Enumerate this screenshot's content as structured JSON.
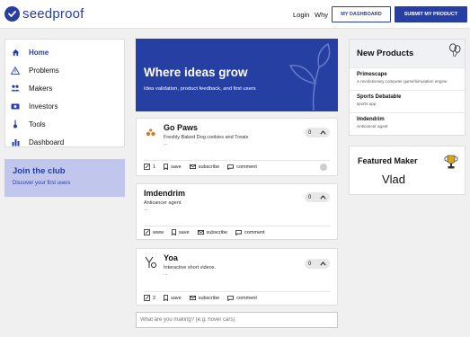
{
  "header": {
    "brand": "seedproof",
    "login_label": "Login",
    "why_label": "Why",
    "dashboard_label": "MY DASHBOARD",
    "submit_label": "SUBMIT MY PRODUCT"
  },
  "sidebar": {
    "items": [
      {
        "label": "Home",
        "icon": "home-icon"
      },
      {
        "label": "Problems",
        "icon": "warning-icon"
      },
      {
        "label": "Makers",
        "icon": "users-icon"
      },
      {
        "label": "Investors",
        "icon": "money-icon"
      },
      {
        "label": "Tools",
        "icon": "tools-icon"
      },
      {
        "label": "Dashboard",
        "icon": "chart-icon"
      }
    ]
  },
  "club": {
    "title": "Join the club",
    "subtitle": "Discover your first users"
  },
  "hero": {
    "title": "Where ideas grow",
    "subtitle": "Idea validation, product feedback, and first users"
  },
  "products": [
    {
      "name": "Go Paws",
      "tagline": "Freshly Baked Dog cookies and Treats",
      "dots": "...",
      "votes": "0",
      "comments_count": "1",
      "save": "save",
      "subscribe": "subscribe",
      "comment": "comment"
    },
    {
      "name": "Imdendrim",
      "tagline": "Anticancer agent",
      "dots": "...",
      "votes": "0",
      "link": "www",
      "save": "save",
      "subscribe": "subscribe",
      "comment": "comment"
    },
    {
      "name": "Yoa",
      "tagline": "Interactive short videos.",
      "dots": "...",
      "votes": "0",
      "comments_count": "2",
      "save": "save",
      "subscribe": "subscribe",
      "comment": "comment"
    }
  ],
  "compose": {
    "placeholder": "What are you making? (e.g. hover cars)"
  },
  "new_products": {
    "title": "New Products",
    "items": [
      {
        "name": "Primescape",
        "desc": "A revolutionary computer game/simulation engine"
      },
      {
        "name": "Sports Debatable",
        "desc": "sports app"
      },
      {
        "name": "Imdendrim",
        "desc": "Anticancer agent"
      }
    ]
  },
  "featured": {
    "title": "Featured Maker",
    "name": "Vlad"
  },
  "colors": {
    "brand": "#273ea5",
    "club_bg": "#c1c6ec",
    "page_bg": "#f0f0f0"
  }
}
